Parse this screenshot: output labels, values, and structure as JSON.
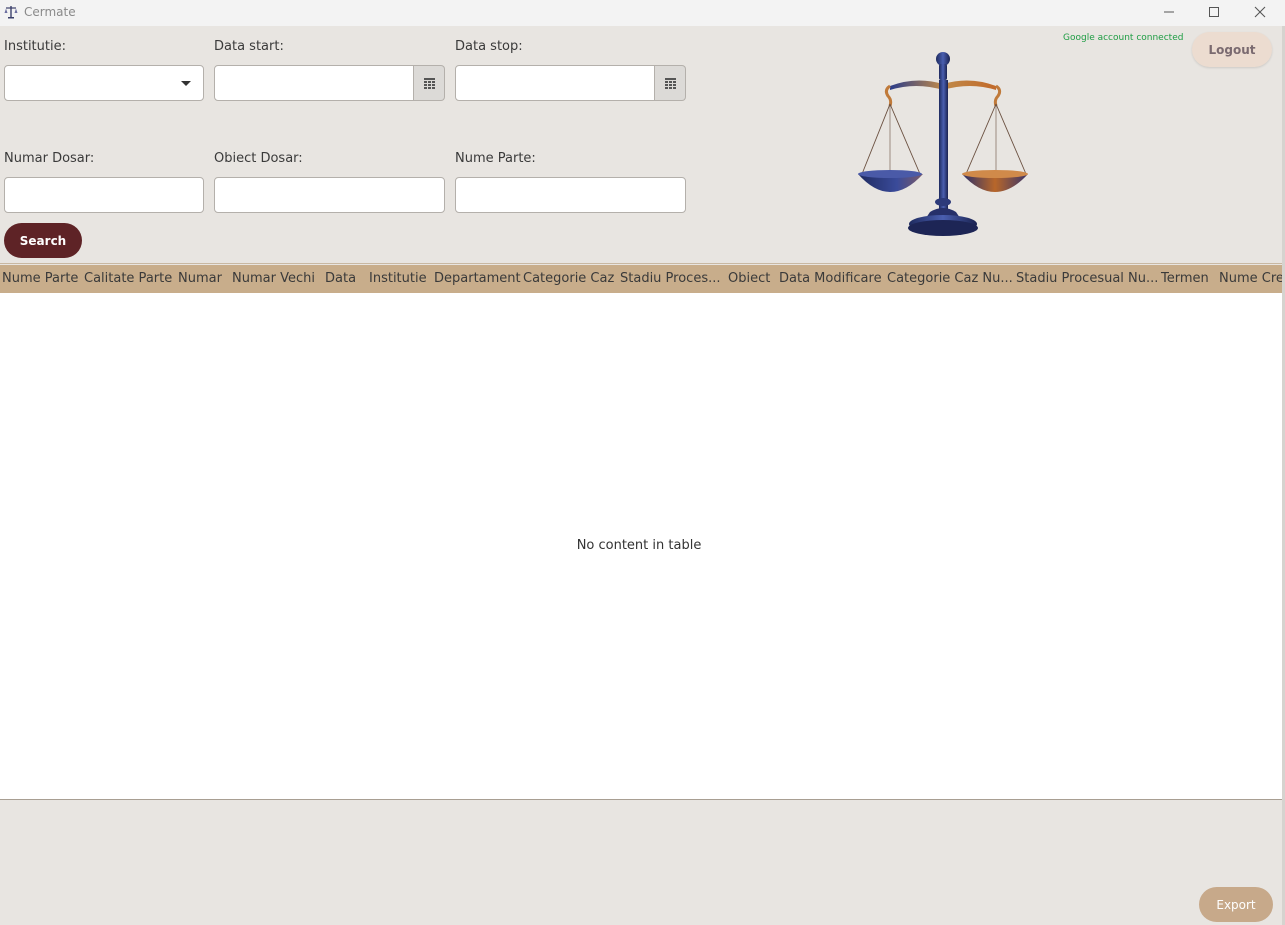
{
  "window": {
    "title": "Cermate"
  },
  "filters": {
    "institutie_label": "Institutie:",
    "data_start_label": "Data start:",
    "data_stop_label": "Data stop:",
    "numar_dosar_label": "Numar Dosar:",
    "obiect_dosar_label": "Obiect Dosar:",
    "nume_parte_label": "Nume Parte:",
    "institutie_value": "",
    "data_start_value": "",
    "data_stop_value": "",
    "numar_dosar_value": "",
    "obiect_dosar_value": "",
    "nume_parte_value": ""
  },
  "actions": {
    "search_label": "Search",
    "logout_label": "Logout",
    "export_label": "Export"
  },
  "account": {
    "status": "Google account connected",
    "status_color": "#1f9d44"
  },
  "table": {
    "columns": [
      "Nume Parte",
      "Calitate Parte",
      "Numar",
      "Numar Vechi",
      "Data",
      "Institutie",
      "Departament",
      "Categorie Caz",
      "Stadiu Proces...",
      "Obiect",
      "Data Modificare",
      "Categorie Caz Nu...",
      "Stadiu Procesual Nu...",
      "Termen",
      "Nume Cre"
    ],
    "empty_message": "No content in table"
  },
  "colors": {
    "search_bg": "#5e2326",
    "header_bg": "#c8ad8b",
    "logout_bg": "#ecdcd0",
    "export_bg": "#c7a98a"
  },
  "icons": {
    "app": "scales-icon",
    "calendar": "calendar-icon",
    "dropdown": "chevron-down-icon"
  }
}
